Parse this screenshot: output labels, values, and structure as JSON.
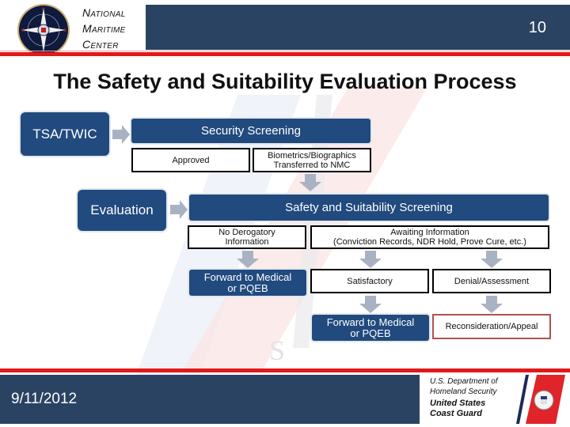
{
  "header": {
    "org_line1": "National",
    "org_line2": "Maritime",
    "org_line3": "Center",
    "slide_number": "10"
  },
  "title": "The Safety and Suitability Evaluation Process",
  "diagram": {
    "tsa_twic": "TSA/TWIC",
    "security_screening": "Security Screening",
    "approved": "Approved",
    "biometrics_line1": "Biometrics/Biographics",
    "biometrics_line2": "Transferred to NMC",
    "evaluation": "Evaluation",
    "safety_screening": "Safety and Suitability Screening",
    "no_derog_line1": "No Derogatory",
    "no_derog_line2": "Information",
    "awaiting_line1": "Awaiting Information",
    "awaiting_line2": "(Conviction Records, NDR Hold, Prove Cure, etc.)",
    "forward1_line1": "Forward to Medical",
    "forward1_line2": "or PQEB",
    "satisfactory": "Satisfactory",
    "denial": "Denial/Assessment",
    "forward2_line1": "Forward to Medical",
    "forward2_line2": "or PQEB",
    "reconsideration": "Reconsideration/Appeal"
  },
  "footer": {
    "date": "9/11/2012",
    "dept_line1": "U.S. Department of",
    "dept_line2": "Homeland Security",
    "cg_line1": "United States",
    "cg_line2": "Coast Guard"
  },
  "colors": {
    "header_blue": "#2a4363",
    "box_blue": "#214a7e",
    "accent_red": "#e01a1a",
    "arrow_gray": "#a9b2c3",
    "appeal_border": "#b05050"
  }
}
